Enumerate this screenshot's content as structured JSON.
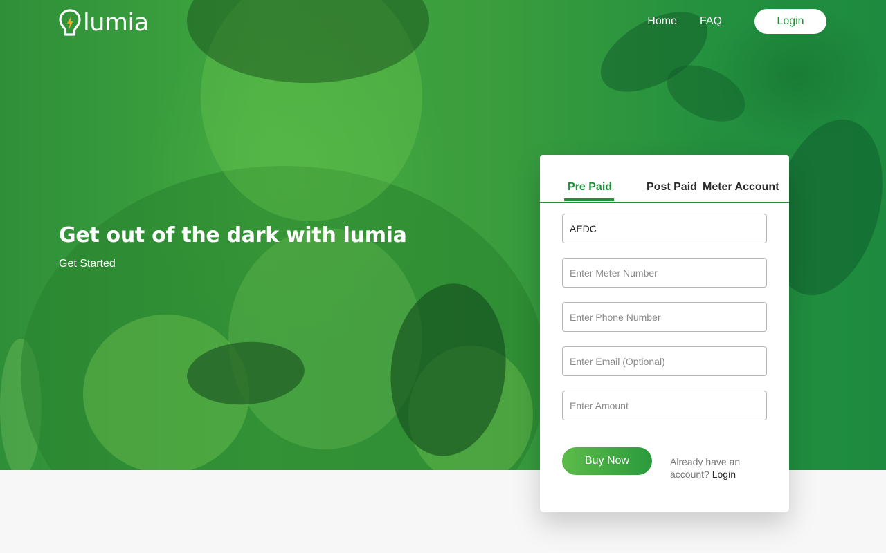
{
  "brand": {
    "name": "lumia"
  },
  "nav": {
    "home": "Home",
    "faq": "FAQ",
    "login": "Login"
  },
  "hero": {
    "headline": "Get out of the dark with lumia",
    "cta": "Get Started"
  },
  "form": {
    "tabs": [
      "Pre Paid",
      "Post Paid",
      "Meter Account"
    ],
    "active_tab": "Pre Paid",
    "disco_value": "AEDC",
    "meter_placeholder": "Enter Meter Number",
    "phone_placeholder": "Enter Phone Number",
    "email_placeholder": "Enter Email (Optional)",
    "amount_placeholder": "Enter Amount",
    "buy_label": "Buy Now",
    "account_prompt": "Already have an account?",
    "account_login": "Login"
  },
  "colors": {
    "brand_green": "#1f8f3a",
    "button_gradient_start": "#5dbb4a",
    "button_gradient_end": "#2a9a3c",
    "bulb_bolt": "#f5a623"
  },
  "icons": {
    "logo": "lightbulb-bolt-icon"
  }
}
